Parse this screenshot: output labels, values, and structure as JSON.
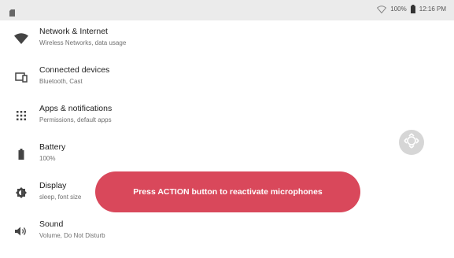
{
  "status_bar": {
    "battery_percent": "100%",
    "time": "12:16 PM",
    "left_icon": "sd-card-icon",
    "icons": [
      "wifi-icon",
      "battery-full-icon"
    ]
  },
  "settings": {
    "items": [
      {
        "title": "Network & Internet",
        "subtitle": "Wireless Networks, data usage",
        "icon": "wifi-icon"
      },
      {
        "title": "Connected devices",
        "subtitle": "Bluetooth, Cast",
        "icon": "devices-icon"
      },
      {
        "title": "Apps & notifications",
        "subtitle": "Permissions, default apps",
        "icon": "apps-grid-icon"
      },
      {
        "title": "Battery",
        "subtitle": "100%",
        "icon": "battery-icon"
      },
      {
        "title": "Display",
        "subtitle": "sleep, font size",
        "icon": "brightness-icon"
      },
      {
        "title": "Sound",
        "subtitle": "Volume, Do Not Disturb",
        "icon": "volume-icon"
      }
    ]
  },
  "toast": {
    "message": "Press ACTION button to reactivate microphones"
  },
  "floating_button": {
    "icon": "move-arrows-icon"
  },
  "colors": {
    "toast_bg": "#d9485b",
    "status_bar_bg": "#ebebeb",
    "icon": "#444444"
  }
}
